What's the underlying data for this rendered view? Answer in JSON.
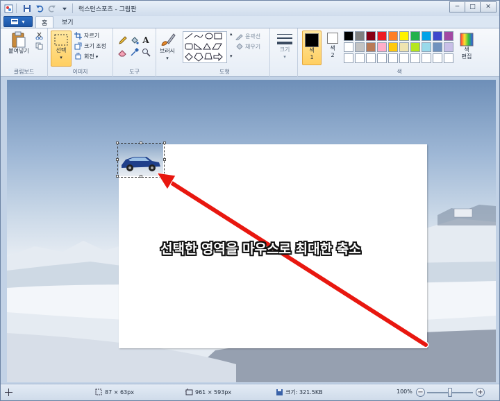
{
  "window": {
    "title": "럭스턴스포츠 - 그림판",
    "buttons": {
      "minimize": "─",
      "maximize": "□",
      "close": "✕"
    }
  },
  "tabs": {
    "app_menu": "▾",
    "items": [
      {
        "label": "홈",
        "active": true
      },
      {
        "label": "보기",
        "active": false
      }
    ]
  },
  "ribbon": {
    "clipboard": {
      "label": "클립보드",
      "paste": "붙여넣기"
    },
    "image": {
      "label": "이미지",
      "select": "선택",
      "crop": "자르기",
      "resize": "크기 조정",
      "rotate": "회전"
    },
    "tools": {
      "label": "도구"
    },
    "brushes": {
      "label": "브러시"
    },
    "shapes": {
      "label": "도형",
      "outline": "윤곽선",
      "fill": "채우기"
    },
    "size": {
      "label": "크기"
    },
    "colors": {
      "label": "색",
      "color1": "색\n1",
      "color1_a": "색",
      "color1_b": "1",
      "color2_a": "색",
      "color2_b": "2",
      "edit_a": "색",
      "edit_b": "편집",
      "palette_row1": [
        "#000000",
        "#7f7f7f",
        "#880015",
        "#ed1c24",
        "#ff7f27",
        "#fff200",
        "#22b14c",
        "#00a2e8",
        "#3f48cc",
        "#a349a4"
      ],
      "palette_row2": [
        "#ffffff",
        "#c3c3c3",
        "#b97a57",
        "#ffaec9",
        "#ffc90e",
        "#efe4b0",
        "#b5e61d",
        "#99d9ea",
        "#7092be",
        "#c8bfe7"
      ],
      "palette_row3": [
        "#ffffff",
        "#ffffff",
        "#ffffff",
        "#ffffff",
        "#ffffff",
        "#ffffff",
        "#ffffff",
        "#ffffff",
        "#ffffff",
        "#ffffff"
      ]
    }
  },
  "canvas": {
    "caption": "선택한 영역을 마우스로 최대한 축소"
  },
  "status": {
    "selection_size": "87 × 63px",
    "image_size": "961 × 593px",
    "file_size": "크기: 321.5KB",
    "zoom": "100%",
    "zoom_out": "−",
    "zoom_in": "+"
  }
}
